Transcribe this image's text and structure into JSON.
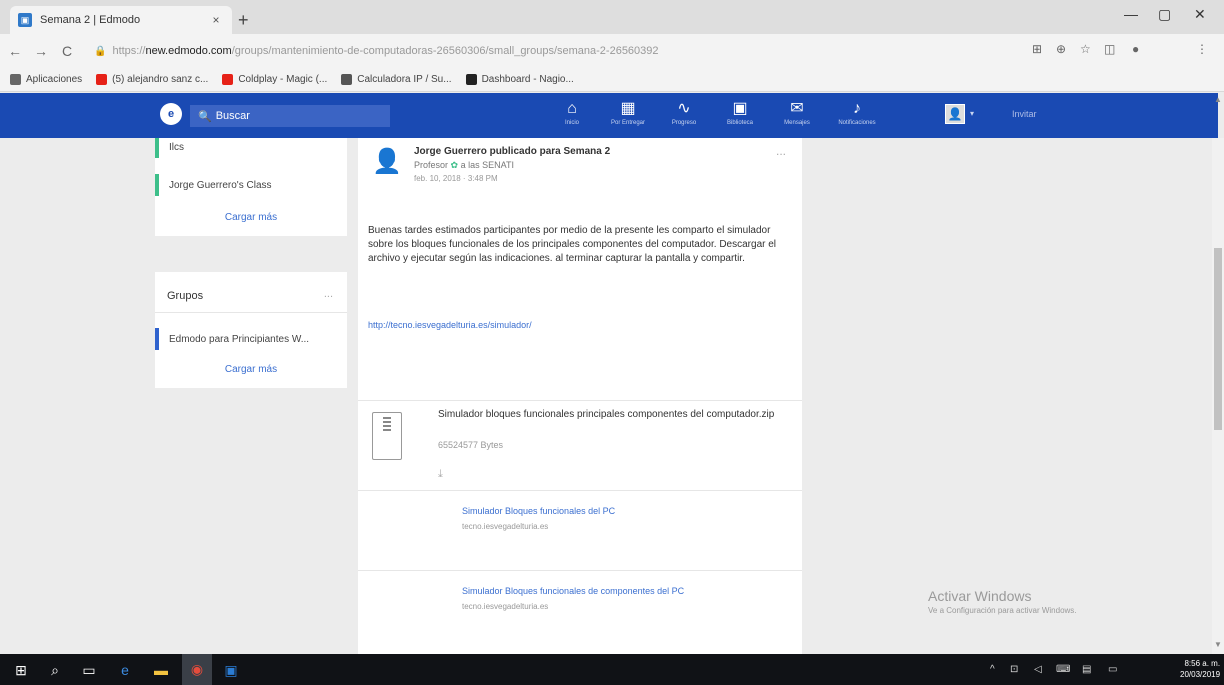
{
  "browser": {
    "tab_title": "Semana 2 | Edmodo",
    "tab_close": "×",
    "new_tab": "+",
    "minimize": "—",
    "maximize": "▢",
    "close": "✕",
    "back": "←",
    "forward": "→",
    "reload": "C",
    "url_scheme": "https://",
    "url_host": "new.edmodo.com",
    "url_path": "/groups/mantenimiento-de-computadoras-26560306/small_groups/semana-2-26560392",
    "bookmarks": [
      {
        "label": "Aplicaciones",
        "color": "#666666"
      },
      {
        "label": "(5) alejandro sanz c...",
        "color": "#e62117"
      },
      {
        "label": "Coldplay - Magic (...",
        "color": "#e62117"
      },
      {
        "label": "Calculadora IP / Su...",
        "color": "#555555"
      },
      {
        "label": "Dashboard - Nagio...",
        "color": "#222222"
      }
    ]
  },
  "edmodo": {
    "logo": "e",
    "search_label": "Buscar",
    "nav": [
      {
        "label": "Inicio",
        "icon": "home-icon"
      },
      {
        "label": "Por Entregar",
        "icon": "calendar-icon"
      },
      {
        "label": "Progreso",
        "icon": "progress-icon"
      },
      {
        "label": "Biblioteca",
        "icon": "library-icon"
      },
      {
        "label": "Mensajes",
        "icon": "messages-icon"
      },
      {
        "label": "Notificaciones",
        "icon": "notifications-icon"
      }
    ],
    "invite": "Invitar",
    "accent": "#1a4ab3"
  },
  "sidebar": {
    "classes": [
      "Ilcs",
      "Jorge Guerrero's Class"
    ],
    "load_more": "Cargar más",
    "groups_title": "Grupos",
    "groups_menu": "...",
    "groups": [
      "Edmodo para Principiantes W..."
    ],
    "groups_load_more": "Cargar más"
  },
  "post": {
    "author": "Jorge Guerrero publicado para Semana 2",
    "role": "Profesor",
    "role_suffix": "a las SENATI",
    "date": "feb. 10, 2018 · 3:48 PM",
    "menu": "...",
    "body": "Buenas tardes estimados participantes por medio de la presente les comparto el simulador sobre los bloques funcionales de los principales componentes del computador. Descargar el archivo y ejecutar según las indicaciones. al terminar capturar la pantalla y compartir.",
    "link": "http://tecno.iesvegadelturia.es/simulador/",
    "file": {
      "name": "Simulador bloques funcionales principales componentes del computador.zip",
      "size": "65524577 Bytes"
    },
    "links": [
      {
        "title": "Simulador Bloques funcionales del PC",
        "host": "tecno.iesvegadelturia.es"
      },
      {
        "title": "Simulador Bloques funcionales de componentes del PC",
        "host": "tecno.iesvegadelturia.es"
      }
    ]
  },
  "watermark": {
    "line1": "Activar Windows",
    "line2": "Ve a Configuración para activar Windows."
  },
  "taskbar": {
    "time": "8:56 a. m.",
    "date": "20/03/2019"
  }
}
